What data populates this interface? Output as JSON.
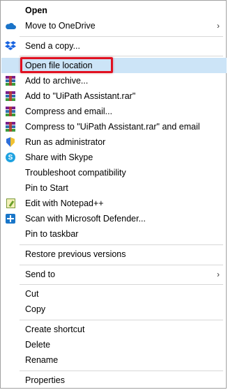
{
  "menu": {
    "items": [
      {
        "label": "Open",
        "icon": "",
        "arrow": false
      },
      {
        "label": "Move to OneDrive",
        "icon": "onedrive-icon",
        "arrow": true
      },
      {
        "label": "Send a copy...",
        "icon": "dropbox-icon",
        "arrow": false
      },
      {
        "label": "Open file location",
        "icon": "",
        "arrow": false,
        "highlighted": true
      },
      {
        "label": "Add to archive...",
        "icon": "winrar-icon",
        "arrow": false
      },
      {
        "label": "Add to \"UiPath Assistant.rar\"",
        "icon": "winrar-icon",
        "arrow": false
      },
      {
        "label": "Compress and email...",
        "icon": "winrar-icon",
        "arrow": false
      },
      {
        "label": "Compress to \"UiPath Assistant.rar\" and email",
        "icon": "winrar-icon",
        "arrow": false
      },
      {
        "label": "Run as administrator",
        "icon": "shield-icon",
        "arrow": false
      },
      {
        "label": "Share with Skype",
        "icon": "skype-icon",
        "arrow": false
      },
      {
        "label": "Troubleshoot compatibility",
        "icon": "",
        "arrow": false
      },
      {
        "label": "Pin to Start",
        "icon": "",
        "arrow": false
      },
      {
        "label": "Edit with Notepad++",
        "icon": "notepad-plus-plus-icon",
        "arrow": false
      },
      {
        "label": "Scan with Microsoft Defender...",
        "icon": "defender-icon",
        "arrow": false
      },
      {
        "label": "Pin to taskbar",
        "icon": "",
        "arrow": false
      },
      {
        "label": "Restore previous versions",
        "icon": "",
        "arrow": false
      },
      {
        "label": "Send to",
        "icon": "",
        "arrow": true
      },
      {
        "label": "Cut",
        "icon": "",
        "arrow": false
      },
      {
        "label": "Copy",
        "icon": "",
        "arrow": false
      },
      {
        "label": "Create shortcut",
        "icon": "",
        "arrow": false
      },
      {
        "label": "Delete",
        "icon": "",
        "arrow": false
      },
      {
        "label": "Rename",
        "icon": "",
        "arrow": false
      },
      {
        "label": "Properties",
        "icon": "",
        "arrow": false
      }
    ],
    "arrow_glyph": "›",
    "skype_letter": "S",
    "colors": {
      "highlight": "#cce4f7",
      "annotation_border": "#e01020"
    }
  }
}
